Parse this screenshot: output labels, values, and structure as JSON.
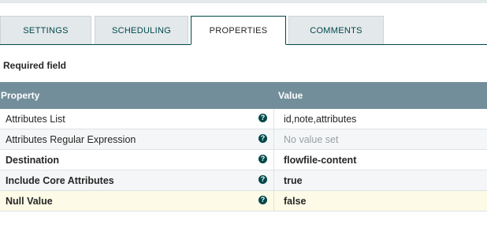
{
  "tabs": [
    {
      "label": "SETTINGS"
    },
    {
      "label": "SCHEDULING"
    },
    {
      "label": "PROPERTIES",
      "active": true
    },
    {
      "label": "COMMENTS"
    }
  ],
  "required_note": "Required field",
  "table": {
    "headers": {
      "property": "Property",
      "value": "Value"
    },
    "rows": [
      {
        "property": "Attributes List",
        "value": "id,note,attributes",
        "required": false,
        "empty": false
      },
      {
        "property": "Attributes Regular Expression",
        "value": "No value set",
        "required": false,
        "empty": true
      },
      {
        "property": "Destination",
        "value": "flowfile-content",
        "required": true,
        "empty": false
      },
      {
        "property": "Include Core Attributes",
        "value": "true",
        "required": true,
        "empty": false
      },
      {
        "property": "Null Value",
        "value": "false",
        "required": true,
        "empty": false
      }
    ]
  },
  "icons": {
    "help": "help-icon",
    "help_glyph": "?"
  },
  "colors": {
    "header_bg": "#728e9b",
    "accent": "#004849",
    "tab_bg": "#e3e8eb",
    "selected_row": "#fdfbe7"
  }
}
